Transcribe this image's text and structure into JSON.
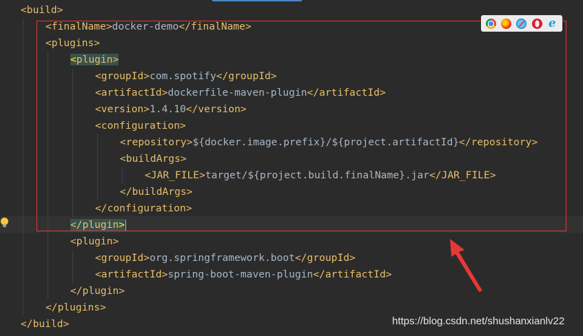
{
  "code_lines": [
    {
      "id": "build-open",
      "parts": [
        {
          "c": "tag",
          "t": "<build>"
        }
      ]
    },
    {
      "id": "finalname",
      "parts": [
        {
          "c": "tag",
          "t": "<finalName>"
        },
        {
          "c": "txt",
          "t": "docker-demo"
        },
        {
          "c": "tag",
          "t": "</finalName>"
        }
      ]
    },
    {
      "id": "plugins-open",
      "parts": [
        {
          "c": "tag",
          "t": "<plugins>"
        }
      ]
    },
    {
      "id": "plugin-open",
      "parts": [
        {
          "c": "hl-bracket",
          "t": "<"
        },
        {
          "c": "hl-tag",
          "t": "plugin>"
        }
      ]
    },
    {
      "id": "groupid",
      "parts": [
        {
          "c": "tag",
          "t": "<groupId>"
        },
        {
          "c": "txt",
          "t": "com.spotify"
        },
        {
          "c": "tag",
          "t": "</groupId>"
        }
      ]
    },
    {
      "id": "artifactid",
      "parts": [
        {
          "c": "tag",
          "t": "<artifactId>"
        },
        {
          "c": "txt",
          "t": "dockerfile-maven-plugin"
        },
        {
          "c": "tag",
          "t": "</artifactId>"
        }
      ]
    },
    {
      "id": "version",
      "parts": [
        {
          "c": "tag",
          "t": "<version>"
        },
        {
          "c": "txt",
          "t": "1.4.10"
        },
        {
          "c": "tag",
          "t": "</version>"
        }
      ]
    },
    {
      "id": "configuration-open",
      "parts": [
        {
          "c": "tag",
          "t": "<configuration>"
        }
      ]
    },
    {
      "id": "repository",
      "parts": [
        {
          "c": "tag",
          "t": "<repository>"
        },
        {
          "c": "txt",
          "t": "${docker.image.prefix}/${project.artifactId}"
        },
        {
          "c": "tag",
          "t": "</repository>"
        }
      ]
    },
    {
      "id": "buildargs-open",
      "parts": [
        {
          "c": "tag",
          "t": "<buildArgs>"
        }
      ]
    },
    {
      "id": "jar-file",
      "parts": [
        {
          "c": "tag",
          "t": "<JAR_FILE>"
        },
        {
          "c": "txt",
          "t": "target/${project.build.finalName}.jar"
        },
        {
          "c": "tag",
          "t": "</JAR_FILE>"
        }
      ]
    },
    {
      "id": "buildargs-close",
      "parts": [
        {
          "c": "tag",
          "t": "</buildArgs>"
        }
      ]
    },
    {
      "id": "configuration-close",
      "parts": [
        {
          "c": "tag",
          "t": "</configuration>"
        }
      ]
    },
    {
      "id": "plugin-close",
      "parts": [
        {
          "c": "hl-tag",
          "t": "</plugin"
        },
        {
          "c": "hl-bracket",
          "t": ">"
        }
      ],
      "caret": true
    },
    {
      "id": "plugin2-open",
      "parts": [
        {
          "c": "tag",
          "t": "<plugin>"
        }
      ]
    },
    {
      "id": "groupid2",
      "parts": [
        {
          "c": "tag",
          "t": "<groupId>"
        },
        {
          "c": "txt",
          "t": "org.springframework.boot"
        },
        {
          "c": "tag",
          "t": "</groupId>"
        }
      ]
    },
    {
      "id": "artifactid2",
      "parts": [
        {
          "c": "tag",
          "t": "<artifactId>"
        },
        {
          "c": "txt",
          "t": "spring-boot-maven-plugin"
        },
        {
          "c": "tag",
          "t": "</artifactId>"
        }
      ]
    },
    {
      "id": "plugin2-close",
      "parts": [
        {
          "c": "tag",
          "t": "</plugin>"
        }
      ]
    },
    {
      "id": "plugins-close",
      "parts": [
        {
          "c": "tag",
          "t": "</plugins>"
        }
      ]
    },
    {
      "id": "build-close",
      "parts": [
        {
          "c": "tag",
          "t": "</build>"
        }
      ]
    }
  ],
  "browser_icons": [
    "chrome-icon",
    "firefox-icon",
    "safari-icon",
    "opera-icon",
    "ie-icon"
  ],
  "ie_glyph": "e",
  "watermark": "https://blog.csdn.net/shushanxianlv22",
  "colors": {
    "background": "#2b2b2b",
    "tag": "#e8bf6a",
    "text": "#a9b7c6",
    "annotation": "#e53935"
  }
}
